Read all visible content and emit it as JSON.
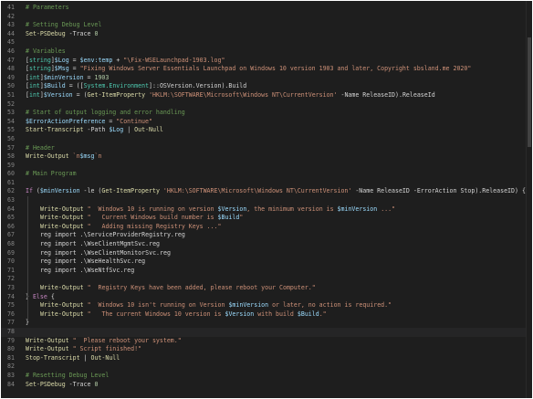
{
  "editor": {
    "theme": {
      "background": "#1e1e1e",
      "default": "#d4d4d4",
      "comment": "#6a9955",
      "variable": "#9cdcfe",
      "string": "#ce9178",
      "type": "#4ec9b0",
      "number": "#b5cea8",
      "keyword": "#c586c0",
      "function": "#dcdcaa",
      "operator": "#d4d4d4",
      "parameter": "#d4d4d4",
      "line_number": "#858585"
    },
    "lines": [
      {
        "n": "41",
        "segs": [
          [
            "# Parameters",
            "comment"
          ]
        ]
      },
      {
        "n": "42",
        "segs": []
      },
      {
        "n": "43",
        "segs": [
          [
            "# Setting Debug Level",
            "comment"
          ]
        ]
      },
      {
        "n": "44",
        "segs": [
          [
            "Set-PSDebug",
            "function"
          ],
          [
            " -Trace ",
            "parameter"
          ],
          [
            "0",
            "number"
          ]
        ]
      },
      {
        "n": "45",
        "segs": []
      },
      {
        "n": "46",
        "segs": [
          [
            "# Variables",
            "comment"
          ]
        ]
      },
      {
        "n": "47",
        "segs": [
          [
            "[",
            "operator"
          ],
          [
            "string",
            "type"
          ],
          [
            "]",
            "operator"
          ],
          [
            "$Log",
            "variable"
          ],
          [
            " = ",
            "operator"
          ],
          [
            "$env:temp",
            "variable"
          ],
          [
            " + ",
            "operator"
          ],
          [
            "\"\\Fix-WSELaunchpad-1903.log\"",
            "string"
          ]
        ]
      },
      {
        "n": "48",
        "segs": [
          [
            "[",
            "operator"
          ],
          [
            "string",
            "type"
          ],
          [
            "]",
            "operator"
          ],
          [
            "$Msg",
            "variable"
          ],
          [
            " = ",
            "operator"
          ],
          [
            "\"Fixing Windows Server Essentials Launchpad on Windows 10 version 1903 and later, Copyright sbsland.me 2020\"",
            "string"
          ]
        ]
      },
      {
        "n": "49",
        "segs": [
          [
            "[",
            "operator"
          ],
          [
            "int",
            "type"
          ],
          [
            "]",
            "operator"
          ],
          [
            "$minVersion",
            "variable"
          ],
          [
            " = ",
            "operator"
          ],
          [
            "1903",
            "number"
          ]
        ]
      },
      {
        "n": "50",
        "segs": [
          [
            "[",
            "operator"
          ],
          [
            "int",
            "type"
          ],
          [
            "]",
            "operator"
          ],
          [
            "$Build",
            "variable"
          ],
          [
            " = ([",
            "operator"
          ],
          [
            "System.Environment",
            "type"
          ],
          [
            "]::OSVersion.Version).Build",
            "operator"
          ]
        ]
      },
      {
        "n": "51",
        "segs": [
          [
            "[",
            "operator"
          ],
          [
            "int",
            "type"
          ],
          [
            "]",
            "operator"
          ],
          [
            "$Version",
            "variable"
          ],
          [
            " = (",
            "operator"
          ],
          [
            "Get-ItemProperty",
            "function"
          ],
          [
            " ",
            "operator"
          ],
          [
            "'HKLM:\\SOFTWARE\\Microsoft\\Windows NT\\CurrentVersion'",
            "string"
          ],
          [
            " -Name ReleaseID).ReleaseId",
            "parameter"
          ]
        ]
      },
      {
        "n": "52",
        "segs": []
      },
      {
        "n": "53",
        "segs": [
          [
            "# Start of output logging and error handling",
            "comment"
          ]
        ]
      },
      {
        "n": "54",
        "segs": [
          [
            "$ErrorActionPreference",
            "variable"
          ],
          [
            " = ",
            "operator"
          ],
          [
            "\"Continue\"",
            "string"
          ]
        ]
      },
      {
        "n": "55",
        "segs": [
          [
            "Start-Transcript",
            "function"
          ],
          [
            " -Path ",
            "parameter"
          ],
          [
            "$Log",
            "variable"
          ],
          [
            " | ",
            "operator"
          ],
          [
            "Out-Null",
            "function"
          ]
        ]
      },
      {
        "n": "56",
        "segs": []
      },
      {
        "n": "57",
        "segs": [
          [
            "# Header",
            "comment"
          ]
        ]
      },
      {
        "n": "58",
        "segs": [
          [
            "Write-Output",
            "function"
          ],
          [
            " ",
            "operator"
          ],
          [
            "`n",
            "string"
          ],
          [
            "$msg",
            "variable"
          ],
          [
            "`n",
            "string"
          ]
        ]
      },
      {
        "n": "59",
        "segs": []
      },
      {
        "n": "60",
        "segs": [
          [
            "# Main Program",
            "comment"
          ]
        ]
      },
      {
        "n": "61",
        "segs": []
      },
      {
        "n": "62",
        "segs": [
          [
            "If",
            "keyword"
          ],
          [
            " (",
            "operator"
          ],
          [
            "$minVersion",
            "variable"
          ],
          [
            " -le (",
            "operator"
          ],
          [
            "Get-ItemProperty",
            "function"
          ],
          [
            " ",
            "operator"
          ],
          [
            "'HKLM:\\SOFTWARE\\Microsoft\\Windows NT\\CurrentVersion'",
            "string"
          ],
          [
            " -Name ReleaseID -ErrorAction Stop).ReleaseID) {",
            "parameter"
          ]
        ]
      },
      {
        "n": "63",
        "segs": []
      },
      {
        "n": "64",
        "indent": 1,
        "segs": [
          [
            "Write-Output",
            "function"
          ],
          [
            " \"  Windows 10 is running on version ",
            "string"
          ],
          [
            "$Version",
            "variable"
          ],
          [
            ", the minimum version is ",
            "string"
          ],
          [
            "$minVersion",
            "variable"
          ],
          [
            " ...\"",
            "string"
          ]
        ]
      },
      {
        "n": "65",
        "indent": 1,
        "segs": [
          [
            "Write-Output",
            "function"
          ],
          [
            " \"   Current Windows build number is ",
            "string"
          ],
          [
            "$Build",
            "variable"
          ],
          [
            "\"",
            "string"
          ]
        ]
      },
      {
        "n": "66",
        "indent": 1,
        "segs": [
          [
            "Write-Output",
            "function"
          ],
          [
            " \"   Adding missing Registry Keys ...\"",
            "string"
          ]
        ]
      },
      {
        "n": "67",
        "indent": 1,
        "segs": [
          [
            "reg import .\\ServiceProviderRegistry.reg",
            "default"
          ]
        ]
      },
      {
        "n": "68",
        "indent": 1,
        "segs": [
          [
            "reg import .\\WseClientMgmtSvc.reg",
            "default"
          ]
        ]
      },
      {
        "n": "69",
        "indent": 1,
        "segs": [
          [
            "reg import .\\WseClientMonitorSvc.reg",
            "default"
          ]
        ]
      },
      {
        "n": "70",
        "indent": 1,
        "segs": [
          [
            "reg import .\\WseHealthSvc.reg",
            "default"
          ]
        ]
      },
      {
        "n": "71",
        "indent": 1,
        "segs": [
          [
            "reg import .\\WseNtfSvc.reg",
            "default"
          ]
        ]
      },
      {
        "n": "72",
        "indent": 1,
        "segs": []
      },
      {
        "n": "73",
        "indent": 1,
        "segs": [
          [
            "Write-Output",
            "function"
          ],
          [
            " \"  Registry Keys have been added, please reboot your Computer.\"",
            "string"
          ]
        ]
      },
      {
        "n": "74",
        "segs": [
          [
            "} ",
            "operator"
          ],
          [
            "Else",
            "keyword"
          ],
          [
            " {",
            "operator"
          ]
        ]
      },
      {
        "n": "75",
        "indent": 1,
        "segs": [
          [
            "Write-Output",
            "function"
          ],
          [
            " \"  Windows 10 isn't running on Version ",
            "string"
          ],
          [
            "$minVersion",
            "variable"
          ],
          [
            " or later, no action is required.\"",
            "string"
          ]
        ]
      },
      {
        "n": "76",
        "indent": 1,
        "segs": [
          [
            "Write-Output",
            "function"
          ],
          [
            " \"   The current Windows 10 version is ",
            "string"
          ],
          [
            "$Version",
            "variable"
          ],
          [
            " with build ",
            "string"
          ],
          [
            "$Build",
            "variable"
          ],
          [
            ".\"",
            "string"
          ]
        ]
      },
      {
        "n": "77",
        "segs": [
          [
            "}",
            "operator"
          ]
        ]
      },
      {
        "n": "78",
        "cur": true,
        "segs": []
      },
      {
        "n": "79",
        "segs": [
          [
            "Write-Output",
            "function"
          ],
          [
            " \"  Please reboot your system.\"",
            "string"
          ]
        ]
      },
      {
        "n": "80",
        "segs": [
          [
            "Write-Output",
            "function"
          ],
          [
            " \" Script finished!\"",
            "string"
          ]
        ]
      },
      {
        "n": "81",
        "segs": [
          [
            "Stop-Transcript",
            "function"
          ],
          [
            " | ",
            "operator"
          ],
          [
            "Out-Null",
            "function"
          ]
        ]
      },
      {
        "n": "82",
        "segs": []
      },
      {
        "n": "83",
        "segs": [
          [
            "# Resetting Debug Level",
            "comment"
          ]
        ]
      },
      {
        "n": "84",
        "segs": [
          [
            "Set-PSDebug",
            "function"
          ],
          [
            " -Trace ",
            "parameter"
          ],
          [
            "0",
            "number"
          ]
        ]
      }
    ]
  }
}
